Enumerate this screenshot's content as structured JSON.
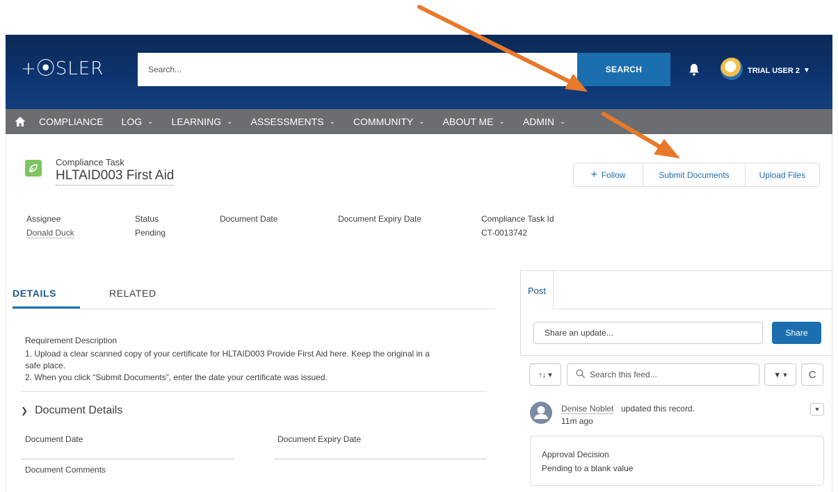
{
  "header": {
    "logo_text": "+⦿SLER",
    "search_placeholder": "Search...",
    "search_button": "SEARCH",
    "user_name": "TRIAL USER 2",
    "caret": "▼"
  },
  "nav": {
    "items": [
      {
        "label": "COMPLIANCE",
        "has_dropdown": false
      },
      {
        "label": "LOG",
        "has_dropdown": true
      },
      {
        "label": "LEARNING",
        "has_dropdown": true
      },
      {
        "label": "ASSESSMENTS",
        "has_dropdown": true
      },
      {
        "label": "COMMUNITY",
        "has_dropdown": true
      },
      {
        "label": "ABOUT ME",
        "has_dropdown": true
      },
      {
        "label": "ADMIN",
        "has_dropdown": true
      }
    ],
    "chevron": "⌵"
  },
  "record": {
    "type": "Compliance Task",
    "title": "HLTAID003 First Aid",
    "buttons": {
      "follow": "Follow",
      "submit": "Submit Documents",
      "upload": "Upload Files"
    },
    "fields": {
      "assignee_label": "Assignee",
      "assignee_value": "Donald Duck",
      "status_label": "Status",
      "status_value": "Pending",
      "doc_date_label": "Document Date",
      "doc_expiry_label": "Document Expiry Date",
      "task_id_label": "Compliance Task Id",
      "task_id_value": "CT-0013742"
    }
  },
  "tabs": {
    "details": "DETAILS",
    "related": "RELATED"
  },
  "details": {
    "req_label": "Requirement Description",
    "req_line1": "1. Upload a clear scanned copy of your certificate for HLTAID003 Provide First Aid here. Keep the original in a",
    "req_line2": "safe place.",
    "req_line3": "2. When you click “Submit Documents”, enter the date your certificate was issued.",
    "section_title": "Document Details",
    "doc_date_label": "Document Date",
    "doc_expiry_label": "Document Expiry Date",
    "doc_comments_label": "Document Comments"
  },
  "chatter": {
    "post_tab": "Post",
    "share_placeholder": "Share an update...",
    "share_button": "Share",
    "feed_search_placeholder": "Search this feed...",
    "sort_label": "↑↓ ▾",
    "filter_label": "▼ ▾",
    "refresh_label": "C",
    "feed_author": "Denise Noblet",
    "feed_action": "updated this record.",
    "feed_time": "11m ago",
    "approval_label": "Approval Decision",
    "approval_value": "Pending to a blank value"
  },
  "colors": {
    "header_bg": "#0d3470",
    "nav_bg": "#6b6d70",
    "accent_blue": "#1b6fae",
    "arrow_orange": "#e8792b",
    "record_icon": "#7dc462"
  }
}
